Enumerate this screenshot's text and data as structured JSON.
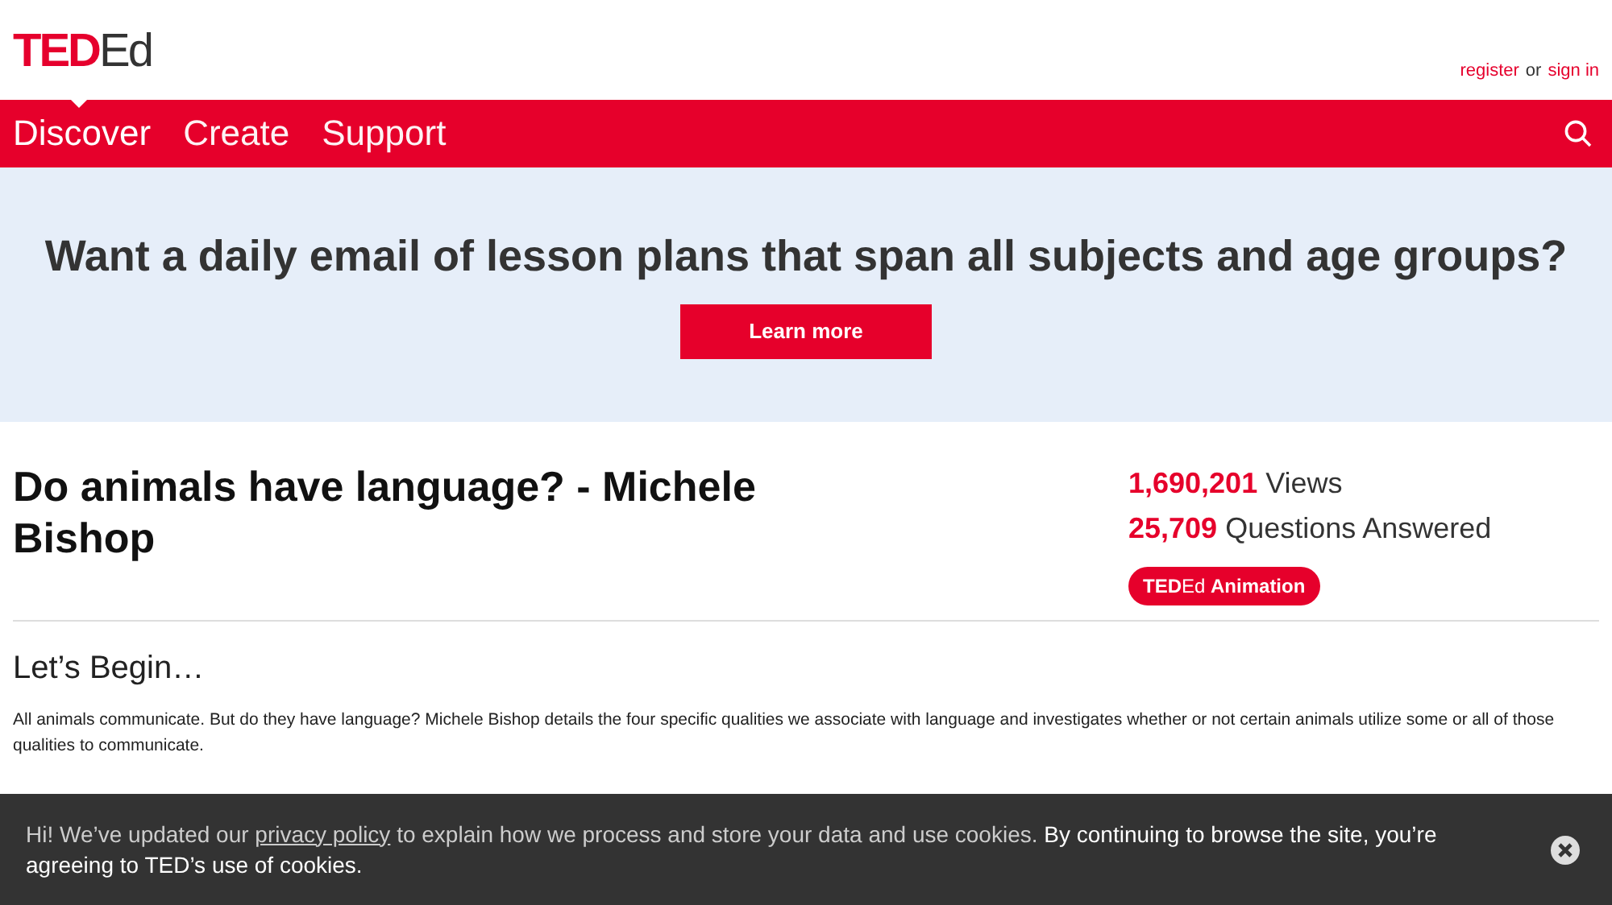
{
  "logo": {
    "red": "TED",
    "dark": "Ed"
  },
  "account": {
    "register": "register",
    "or": "or",
    "sign_in": "sign in"
  },
  "nav": [
    {
      "label": "Discover",
      "selected": true
    },
    {
      "label": "Create",
      "selected": false
    },
    {
      "label": "Support",
      "selected": false
    }
  ],
  "promo": {
    "heading": "Want a daily email of lesson plans that span all subjects and age groups?",
    "button": "Learn more"
  },
  "lesson": {
    "title": "Do animals have language? - Michele Bishop",
    "stats": [
      {
        "value": "1,690,201",
        "label": "Views"
      },
      {
        "value": "25,709",
        "label": "Questions Answered"
      }
    ],
    "badge": "**TED**Ed **Animation**"
  },
  "section": {
    "heading": "Let’s Begin…",
    "body": "All animals communicate. But do they have language? Michele Bishop details the four specific qualities we associate with language and investigates whether or not certain animals utilize some or all of those qualities to communicate."
  },
  "cookie": {
    "before": "Hi! We’ve updated our",
    "link": "privacy policy",
    "middle": "to explain how we process and store your data and use cookies.",
    "bold": "By continuing to browse the site, you’re agreeing to TED’s use of cookies."
  }
}
